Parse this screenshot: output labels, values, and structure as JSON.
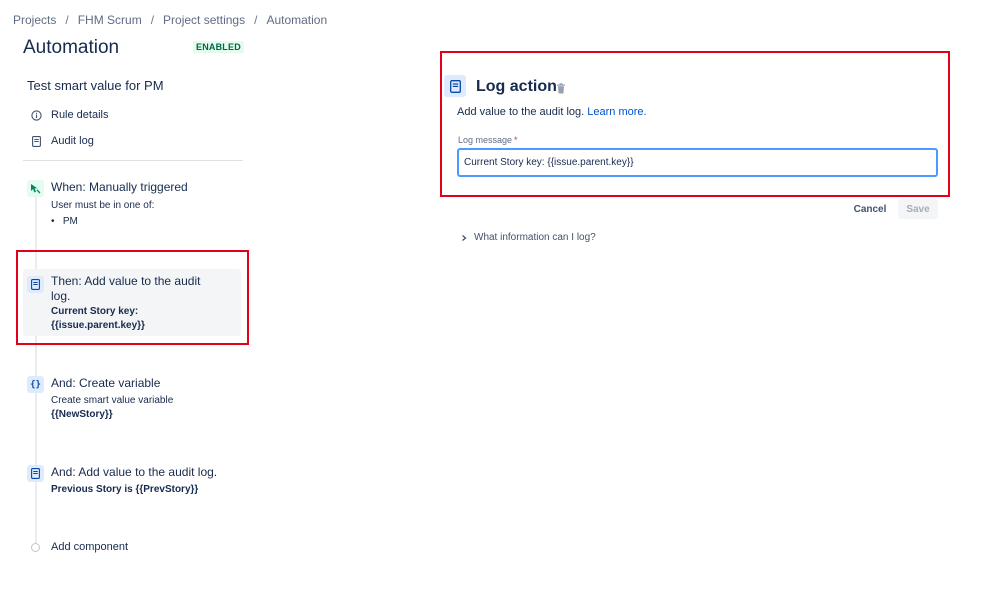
{
  "breadcrumb": {
    "items": [
      "Projects",
      "FHM Scrum",
      "Project settings",
      "Automation"
    ],
    "separator": "/"
  },
  "page": {
    "title": "Automation",
    "status_badge": "ENABLED"
  },
  "rule": {
    "name": "Test smart value for PM",
    "links": [
      {
        "label": "Rule details",
        "icon": "info-icon"
      },
      {
        "label": "Audit log",
        "icon": "document-icon"
      }
    ]
  },
  "components": {
    "trigger": {
      "icon": "trigger-icon",
      "title": "When: Manually triggered",
      "sub": "User must be in one of:",
      "bullet": "PM"
    },
    "action1": {
      "icon": "document-icon",
      "title_line1": "Then: Add value to the audit",
      "title_line2": "log.",
      "bold_line1": "Current Story key:",
      "bold_line2": "{{issue.parent.key}}"
    },
    "variable": {
      "icon": "braces-icon",
      "title": "And: Create variable",
      "sub": "Create smart value variable",
      "bold": "{{NewStory}}"
    },
    "action2": {
      "icon": "document-icon",
      "title": "And: Add value to the audit log.",
      "bold": "Previous Story is {{PrevStory}}"
    },
    "add_component_label": "Add component"
  },
  "panel": {
    "icon": "document-icon",
    "title": "Log action",
    "description": "Add value to the audit log.",
    "learn_more": "Learn more.",
    "field_label": "Log message",
    "required_marker": "*",
    "log_message_value": "Current Story key: {{issue.parent.key}}",
    "cancel_label": "Cancel",
    "save_label": "Save",
    "expander_label": "What information can I log?"
  },
  "colors": {
    "accent": "#0052cc",
    "highlight_border": "#e2001a",
    "badge_bg": "#e3fcef",
    "badge_text": "#006644",
    "trigger_green": "#00875a",
    "action_blue_bg": "#deebff"
  }
}
